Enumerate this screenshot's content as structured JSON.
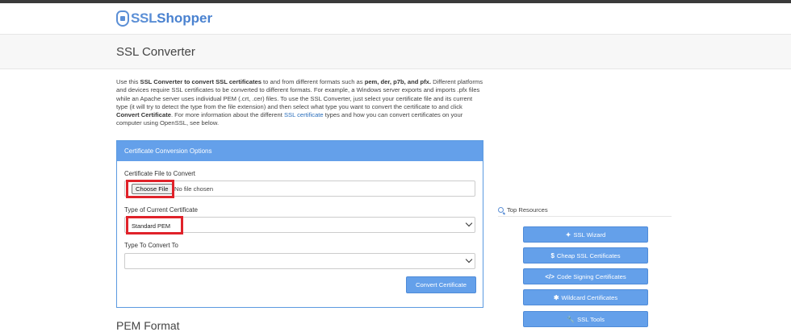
{
  "header": {
    "logo_ssl": "SSL",
    "logo_shopper": "Shopper"
  },
  "page": {
    "title": "SSL Converter"
  },
  "intro": {
    "p1": "Use this ",
    "p1_bold": "SSL Converter to convert SSL certificates",
    "p2": " to and from different formats such as ",
    "p2_bold": "pem, der, p7b, and pfx.",
    "p3": " Different platforms and devices require SSL certificates to be converted to different formats. For example, a Windows server exports and imports .pfx files while an Apache server uses individual PEM (.crt, .cer) files. To use the SSL Converter, just select your certificate file and its current type (it will try to detect the type from the file extension) and then select what type you want to convert the certificate to and click ",
    "p3_bold": "Convert Certificate",
    "p4": ". For more information about the different ",
    "link": "SSL certificate",
    "p5": " types and how you can convert certificates on your computer using OpenSSL, see below."
  },
  "form": {
    "panel_title": "Certificate Conversion Options",
    "file_label": "Certificate File to Convert",
    "choose_file": "Choose File",
    "no_file": "No file chosen",
    "current_type_label": "Type of Current Certificate",
    "current_type_value": "Standard PEM",
    "convert_to_label": "Type To Convert To",
    "convert_to_value": "",
    "convert_button": "Convert Certificate"
  },
  "section": {
    "pem_heading": "PEM Format"
  },
  "resources": {
    "title": "Top Resources",
    "items": [
      {
        "label": "SSL Wizard",
        "icon": "wand-icon",
        "glyph": "✦"
      },
      {
        "label": "Cheap SSL Certificates",
        "icon": "dollar-icon",
        "glyph": "$"
      },
      {
        "label": "Code Signing Certificates",
        "icon": "code-icon",
        "glyph": "</>"
      },
      {
        "label": "Wildcard Certificates",
        "icon": "asterisk-icon",
        "glyph": "✱"
      },
      {
        "label": "SSL Tools",
        "icon": "wrench-icon",
        "glyph": "🔧"
      }
    ]
  },
  "colors": {
    "accent": "#64a0ea",
    "highlight": "#e0222a",
    "link": "#2a6ebb"
  }
}
